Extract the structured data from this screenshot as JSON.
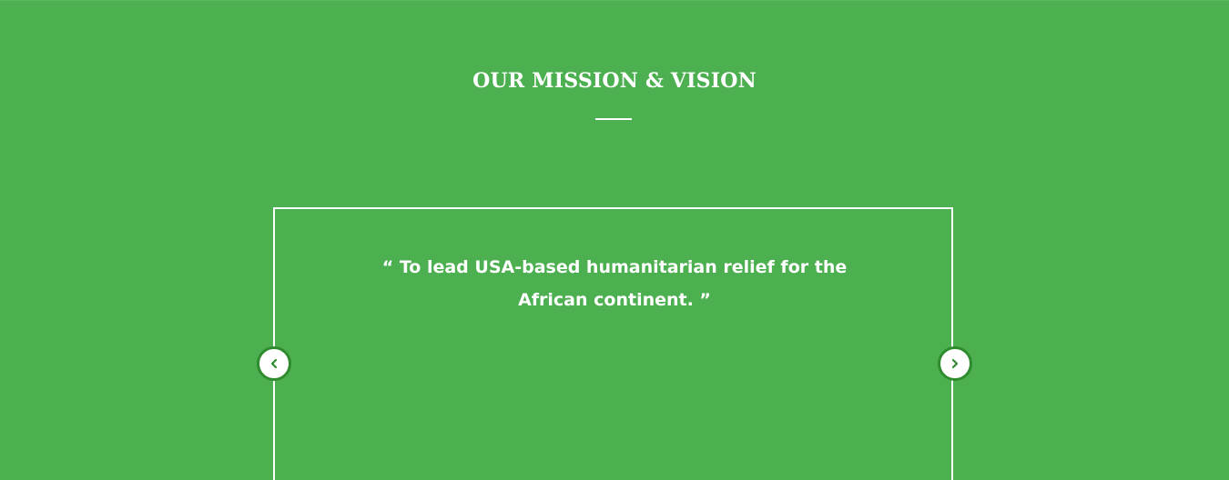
{
  "section": {
    "title": "OUR MISSION & VISION"
  },
  "slider": {
    "quote": "“ To lead USA-based humanitarian relief for the African continent. ”",
    "prev_icon": "chevron-left-icon",
    "next_icon": "chevron-right-icon"
  },
  "colors": {
    "background": "#4caf50",
    "text": "#ffffff",
    "button_border": "#2e8b2e"
  }
}
